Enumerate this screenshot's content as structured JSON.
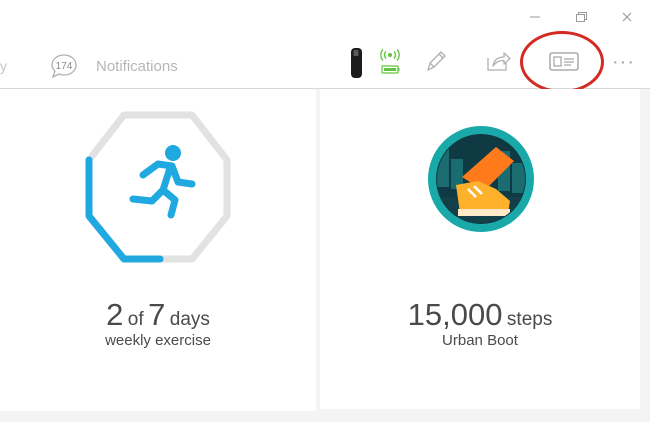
{
  "window": {
    "controls": [
      "minimize",
      "maximize",
      "close"
    ]
  },
  "topbar": {
    "tab_fragment": "y",
    "notifications": {
      "count": "174",
      "label": "Notifications"
    },
    "device": {
      "icon": "tracker-icon",
      "battery_color": "#5fc53a"
    },
    "sync_icon": "sync-icon",
    "edit_icon": "pencil-icon",
    "share_icon": "share-icon",
    "profile_icon": "id-card-icon",
    "more_label": "···",
    "highlight_color": "#d42a24"
  },
  "cards": [
    {
      "value": "2",
      "of": "of",
      "target": "7",
      "unit": "days",
      "label": "weekly exercise",
      "progress": 0.2857,
      "accent": "#20a8e0"
    },
    {
      "value": "15,000",
      "unit": "steps",
      "label": "Urban Boot",
      "badge_colors": [
        "#1aa9a9",
        "#ff7a1a"
      ]
    }
  ]
}
